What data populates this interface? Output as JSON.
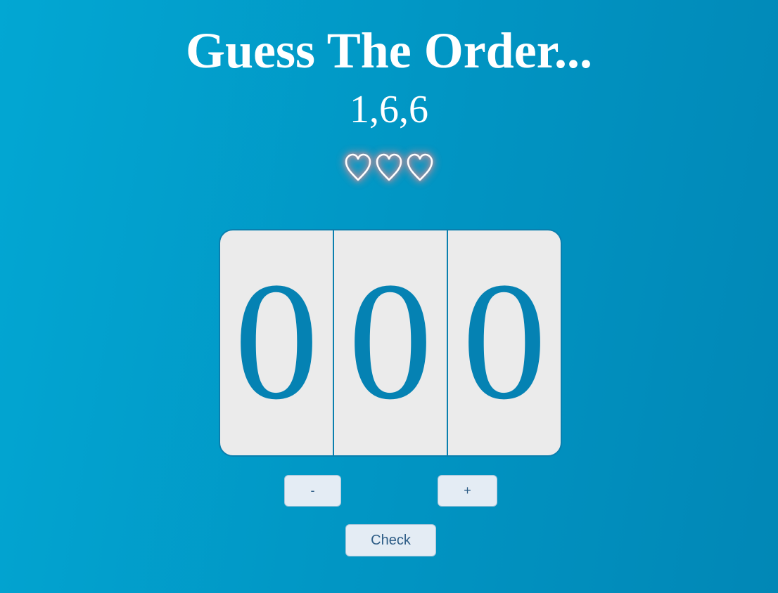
{
  "game": {
    "title": "Guess The Order...",
    "hint": "1,6,6",
    "lives": {
      "count": 3,
      "icon": "heart-outline-icon",
      "glow_color": "#ff6e6e"
    }
  },
  "lock": {
    "digits": [
      "0",
      "0",
      "0"
    ],
    "digit_color": "#0582b3",
    "face_color": "#ebebeb"
  },
  "controls": {
    "minus_label": "-",
    "plus_label": "+",
    "check_label": "Check"
  },
  "colors": {
    "background_start": "#02a7d3",
    "background_end": "#0187b6"
  }
}
